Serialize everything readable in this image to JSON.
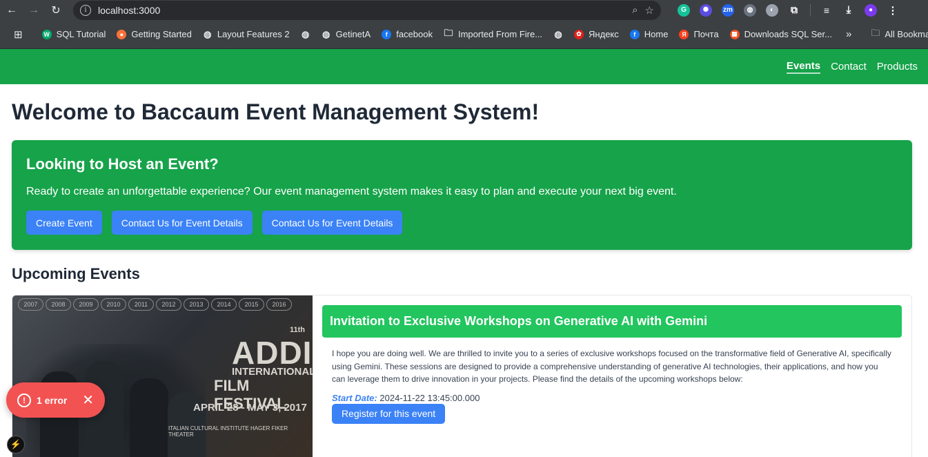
{
  "browser": {
    "url": "localhost:3000",
    "bookmarks": [
      {
        "label": "SQL Tutorial",
        "icon": "w3-icon",
        "color": "#04aa6d"
      },
      {
        "label": "Getting Started",
        "icon": "firefox-icon",
        "color": "#ff7139"
      },
      {
        "label": "Layout Features 2",
        "icon": "globe-icon",
        "color": "#e8eaed"
      },
      {
        "label": "",
        "icon": "globe-icon",
        "color": "#e8eaed"
      },
      {
        "label": "GetinetA",
        "icon": "globe-icon",
        "color": "#e8eaed"
      },
      {
        "label": "facebook",
        "icon": "facebook-icon",
        "color": "#1877f2"
      },
      {
        "label": "Imported From Fire...",
        "icon": "folder-icon",
        "color": "#e8eaed"
      },
      {
        "label": "",
        "icon": "globe-icon",
        "color": "#e8eaed"
      },
      {
        "label": "Яндекс",
        "icon": "huawei-icon",
        "color": "#e0211b"
      },
      {
        "label": "Home",
        "icon": "facebook-icon",
        "color": "#1877f2"
      },
      {
        "label": "Почта",
        "icon": "yandex-icon",
        "color": "#fc3f1d"
      },
      {
        "label": "Downloads SQL Ser...",
        "icon": "microsoft-icon",
        "color": "#f25022"
      }
    ],
    "overflow_label": "»",
    "all_bookmarks": "All Bookmarks"
  },
  "nav": {
    "events": "Events",
    "contact": "Contact",
    "products": "Products"
  },
  "page": {
    "title": "Welcome to Baccaum Event Management System!",
    "host": {
      "title": "Looking to Host an Event?",
      "text": "Ready to create an unforgettable experience? Our event management system makes it easy to plan and execute your next big event.",
      "create_button": "Create Event",
      "contact_button_1": "Contact Us for Event Details",
      "contact_button_2": "Contact Us for Event Details"
    },
    "upcoming_title": "Upcoming Events",
    "event": {
      "title": "Invitation to Exclusive Workshops on Generative AI with Gemini",
      "description": "I hope you are doing well. We are thrilled to invite you to a series of exclusive workshops focused on the transformative field of Generative AI, specifically using Gemini. These sessions are designed to provide a comprehensive understanding of generative AI technologies, their applications, and how you can leverage them to drive innovation in your projects. Please find the details of the upcoming workshops below:",
      "start_label": "Start Date:",
      "start_value": "2024-11-22 13:45:00.000",
      "register_button": "Register for this event",
      "poster": {
        "years": [
          "2007",
          "2008",
          "2009",
          "2010",
          "2011",
          "2012",
          "2013",
          "2014",
          "2015",
          "2016"
        ],
        "edition": "11th",
        "name_1": "ADDIS",
        "name_2": "INTERNATIONAL",
        "name_3": "FILM FESTIVAL",
        "dates": "APRIL 28 - MAY 3, 2017",
        "venues": "ITALIAN CULTURAL INSTITUTE   HAGER FIKER THEATER"
      }
    }
  },
  "overlay": {
    "error_text": "1 error",
    "error_icon": "!",
    "close": "✕",
    "badge": "⚡"
  },
  "colors": {
    "brand_green": "#16a34a",
    "title_green": "#22c55e",
    "button_blue": "#3b82f6",
    "error_red": "#f25252"
  }
}
